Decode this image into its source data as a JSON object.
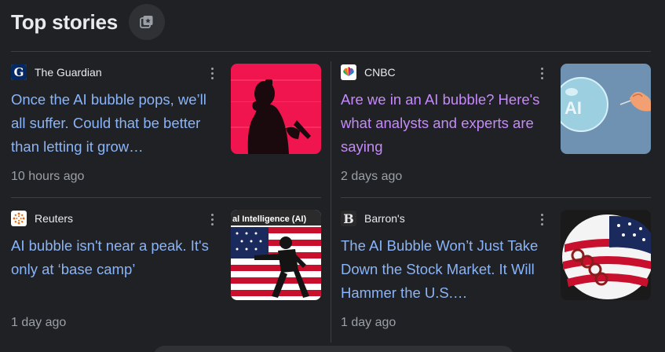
{
  "header": {
    "title": "Top stories"
  },
  "stories": [
    {
      "source": "The Guardian",
      "headline": "Once the AI bubble pops, we’ll all suffer. Could that be better than letting it grow…",
      "time": "10 hours ago",
      "icon": "guardian-logo",
      "visited": false
    },
    {
      "source": "CNBC",
      "headline": "Are we in an AI bubble? Here's what analysts and experts are saying",
      "time": "2 days ago",
      "icon": "cnbc-logo",
      "visited": true
    },
    {
      "source": "Reuters",
      "headline": "AI bubble isn't near a peak. It's only at ‘base camp’",
      "time": "1 day ago",
      "icon": "reuters-logo",
      "visited": false
    },
    {
      "source": "Barron's",
      "headline": "The AI Bubble Won’t Just Take Down the Stock Market. It Will Hammer the U.S.…",
      "time": "1 day ago",
      "icon": "barrons-logo",
      "visited": false
    }
  ],
  "thumbnails": {
    "reuters_caption": "al Intelligence (AI)",
    "cnbc_bubble_text": "AI"
  },
  "colors": {
    "background": "#202124",
    "link": "#8ab4f8",
    "visited_link": "#c58af9",
    "secondary_text": "#9aa0a6",
    "divider": "#3c4043"
  }
}
